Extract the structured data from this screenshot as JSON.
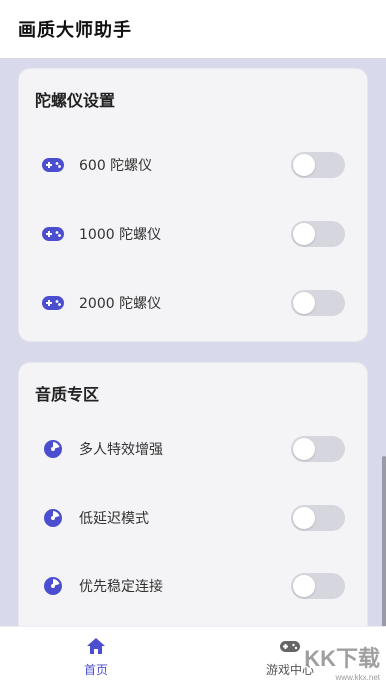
{
  "app": {
    "title": "画质大师助手"
  },
  "gyro_card": {
    "title": "陀螺仪设置",
    "items": [
      {
        "label": "600 陀螺仪",
        "icon": "gamepad-icon",
        "enabled": false
      },
      {
        "label": "1000 陀螺仪",
        "icon": "gamepad-icon",
        "enabled": false
      },
      {
        "label": "2000 陀螺仪",
        "icon": "gamepad-icon",
        "enabled": false
      }
    ]
  },
  "audio_card": {
    "title": "音质专区",
    "items": [
      {
        "label": "多人特效增强",
        "icon": "audio-dial-icon",
        "enabled": false
      },
      {
        "label": "低延迟模式",
        "icon": "audio-dial-icon",
        "enabled": false
      },
      {
        "label": "优先稳定连接",
        "icon": "audio-dial-icon",
        "enabled": false
      }
    ]
  },
  "nav": {
    "home_label": "首页",
    "games_label": "游戏中心"
  },
  "watermark": {
    "main": "KK下载",
    "sub": "www.kkx.net"
  },
  "colors": {
    "accent": "#4b4fcf",
    "background": "#d8d9ea",
    "card": "#f4f4f6",
    "toggle_off": "#d6d6de"
  }
}
